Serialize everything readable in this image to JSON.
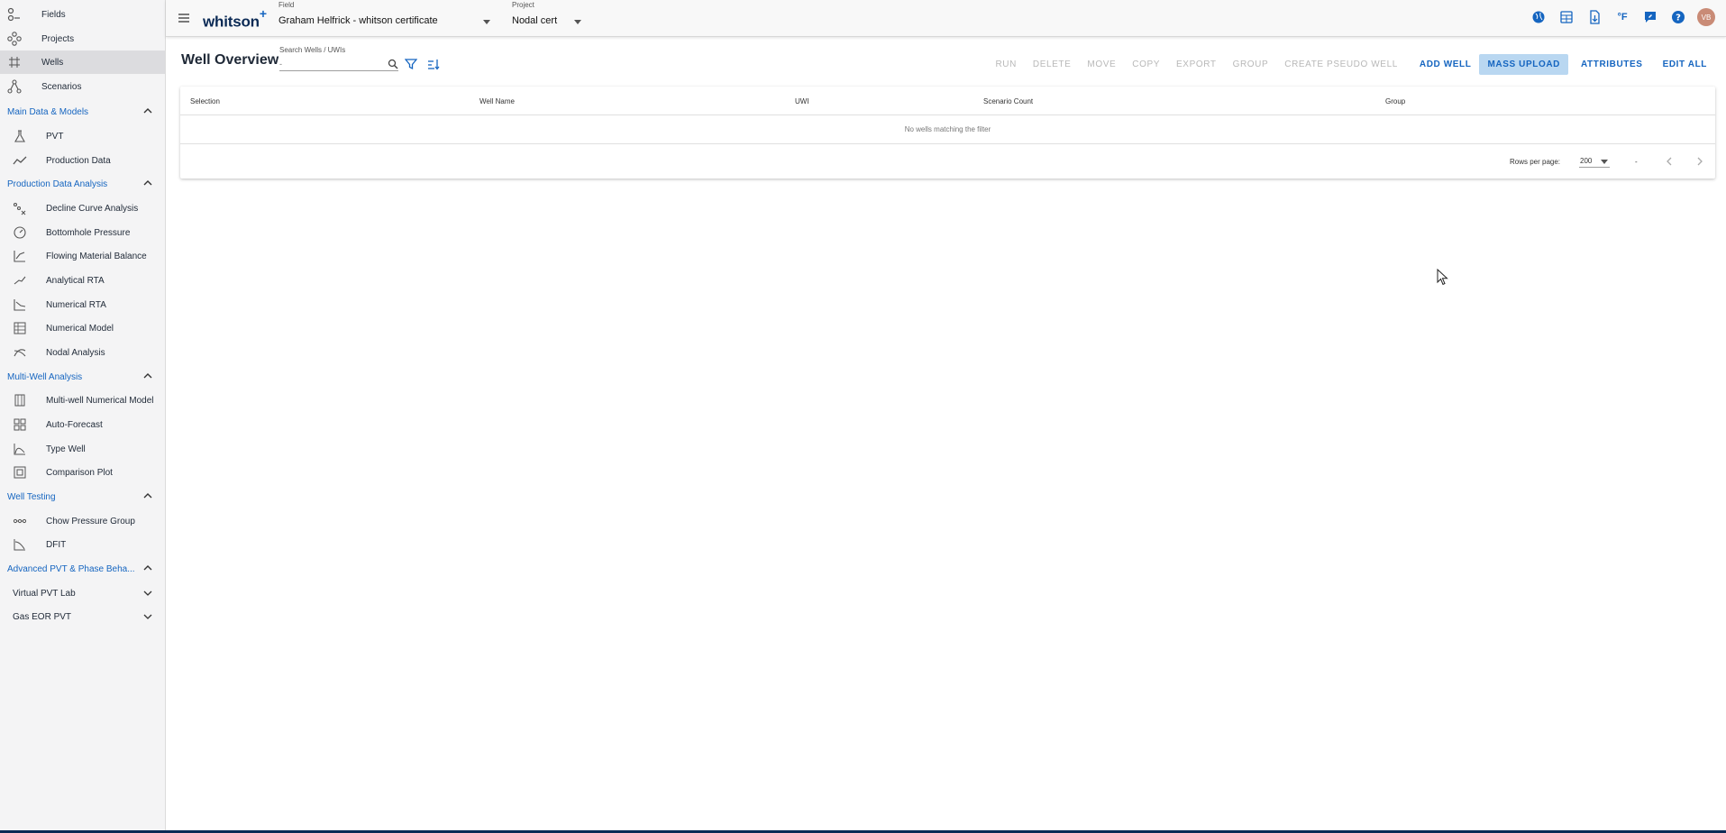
{
  "sidebar": {
    "top_items": [
      {
        "label": "Fields",
        "icon": "fields-icon"
      },
      {
        "label": "Projects",
        "icon": "projects-icon"
      },
      {
        "label": "Wells",
        "icon": "wells-icon",
        "active": true
      },
      {
        "label": "Scenarios",
        "icon": "scenarios-icon"
      }
    ],
    "sections": {
      "main_data": {
        "label": "Main Data & Models",
        "items": [
          "PVT",
          "Production Data"
        ]
      },
      "production_analysis": {
        "label": "Production Data Analysis",
        "items": [
          "Decline Curve Analysis",
          "Bottomhole Pressure",
          "Flowing Material Balance",
          "Analytical RTA",
          "Numerical RTA",
          "Numerical Model",
          "Nodal Analysis"
        ]
      },
      "multi_well": {
        "label": "Multi-Well Analysis",
        "items": [
          "Multi-well Numerical Model",
          "Auto-Forecast",
          "Type Well",
          "Comparison Plot"
        ]
      },
      "well_testing": {
        "label": "Well Testing",
        "items": [
          "Chow Pressure Group",
          "DFIT"
        ]
      },
      "advanced_pvt": {
        "label": "Advanced PVT & Phase Beha...",
        "items": [
          "Virtual PVT Lab",
          "Gas EOR PVT"
        ]
      }
    }
  },
  "header": {
    "logo": "whitson",
    "logo_plus": "+",
    "field_label": "Field",
    "field_value": "Graham Helfrick - whitson certificate",
    "project_label": "Project",
    "project_value": "Nodal cert",
    "avatar_initials": "VB",
    "icons": [
      "globe-icon",
      "calculator-icon",
      "document-icon",
      "fahrenheit-icon",
      "feedback-icon",
      "help-icon"
    ],
    "fahrenheit_text": "°F"
  },
  "main": {
    "title": "Well Overview",
    "search": {
      "label": "Search Wells / UWIs",
      "value": "",
      "placeholder": "-"
    },
    "toolbar": {
      "run": "RUN",
      "delete": "DELETE",
      "move": "MOVE",
      "copy": "COPY",
      "export": "EXPORT",
      "group": "GROUP",
      "create_pseudo": "CREATE PSEUDO WELL",
      "add_well": "ADD WELL",
      "mass_upload": "MASS UPLOAD",
      "attributes": "ATTRIBUTES",
      "edit_all": "EDIT ALL"
    },
    "table": {
      "columns": [
        "Selection",
        "Well Name",
        "UWI",
        "Scenario Count",
        "Group"
      ],
      "empty_message": "No wells matching the filter",
      "rows_per_page_label": "Rows per page:",
      "rows_per_page_value": "200",
      "range_text": "-"
    }
  },
  "colors": {
    "accent": "#1565c0",
    "sidebar_bg": "#f4f4f5",
    "highlight": "#b9d7f1",
    "brand_dark": "#0b2a55"
  }
}
